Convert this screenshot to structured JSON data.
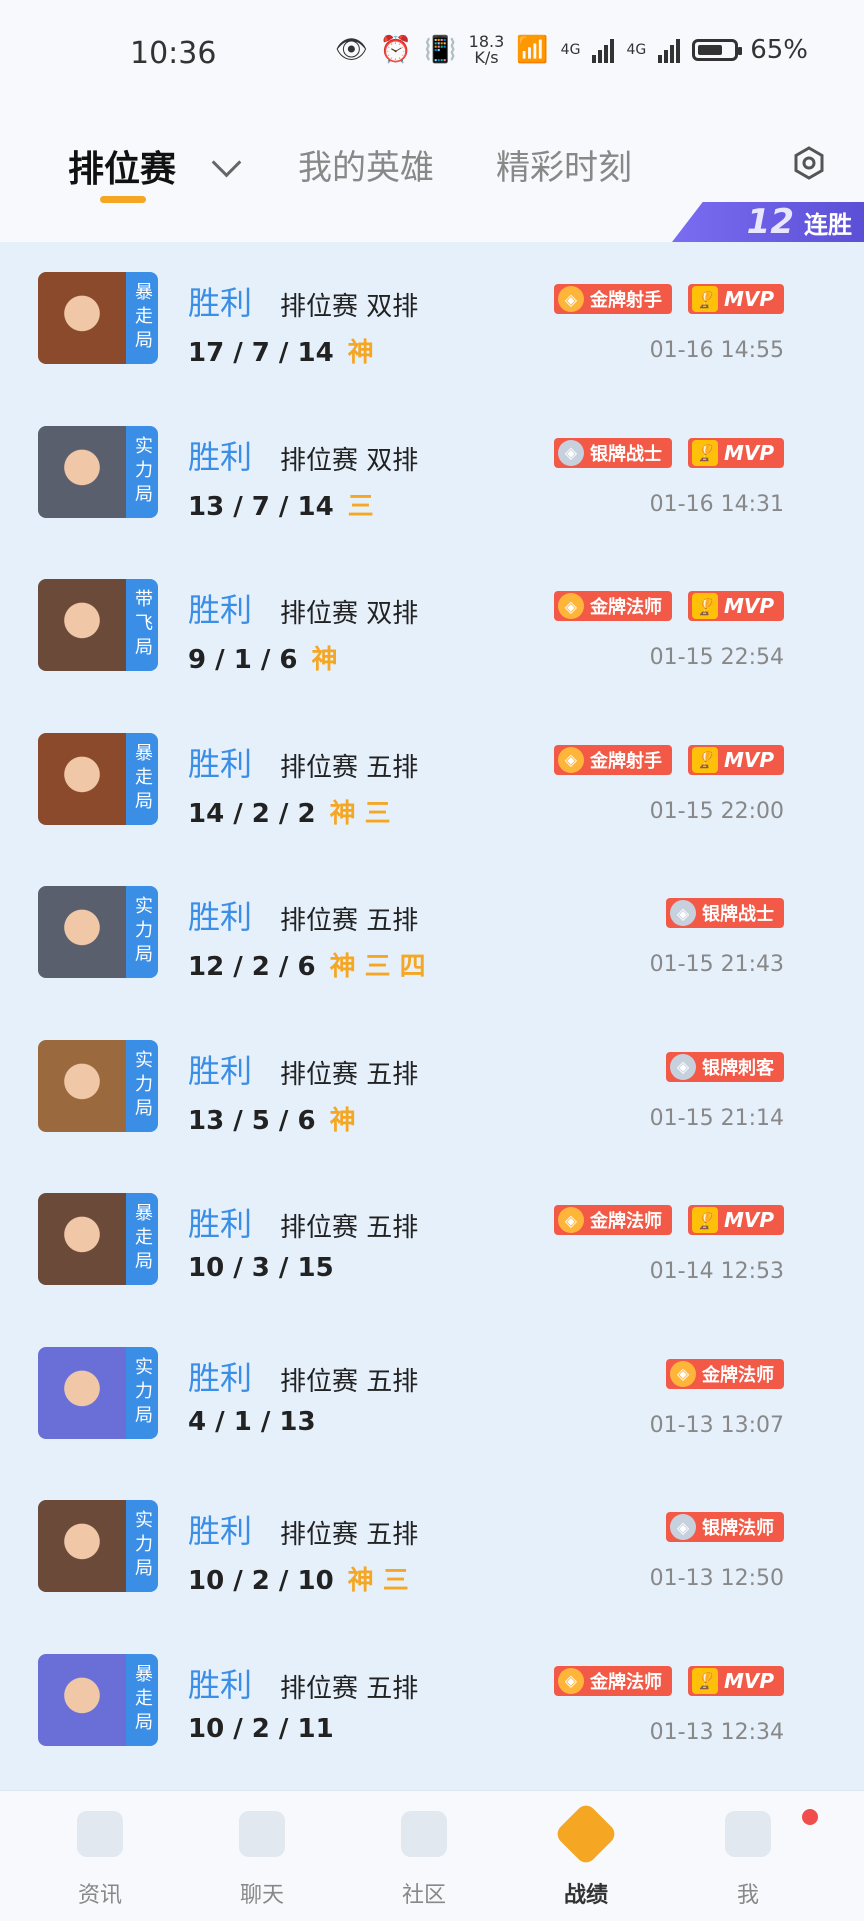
{
  "status_bar": {
    "time": "10:36",
    "speed_value": "18.3",
    "speed_unit": "K/s",
    "net1": "4G",
    "net2": "4G",
    "battery": "65%"
  },
  "header": {
    "tabs": [
      {
        "label": "排位赛",
        "active": true
      },
      {
        "label": "我的英雄",
        "active": false
      },
      {
        "label": "精彩时刻",
        "active": false
      }
    ],
    "streak_number": "12",
    "streak_label": "连胜"
  },
  "matches": [
    {
      "mode_tag": "暴走局",
      "result": "胜利",
      "mode": "排位赛 双排",
      "kda": "17 / 7 / 14",
      "medals": "神",
      "badges": [
        {
          "type": "gold",
          "label": "金牌射手"
        },
        {
          "type": "mvp",
          "label": "MVP"
        }
      ],
      "time": "01-16 14:55",
      "face_color": "#8b4a2b"
    },
    {
      "mode_tag": "实力局",
      "result": "胜利",
      "mode": "排位赛 双排",
      "kda": "13 / 7 / 14",
      "medals": "三",
      "badges": [
        {
          "type": "silver",
          "label": "银牌战士"
        },
        {
          "type": "mvp",
          "label": "MVP"
        }
      ],
      "time": "01-16 14:31",
      "face_color": "#5a5f6e"
    },
    {
      "mode_tag": "带飞局",
      "result": "胜利",
      "mode": "排位赛 双排",
      "kda": "9 / 1 / 6",
      "medals": "神",
      "badges": [
        {
          "type": "gold",
          "label": "金牌法师"
        },
        {
          "type": "mvp",
          "label": "MVP"
        }
      ],
      "time": "01-15 22:54",
      "face_color": "#6b4a3a"
    },
    {
      "mode_tag": "暴走局",
      "result": "胜利",
      "mode": "排位赛 五排",
      "kda": "14 / 2 / 2",
      "medals": "神 三",
      "badges": [
        {
          "type": "gold",
          "label": "金牌射手"
        },
        {
          "type": "mvp",
          "label": "MVP"
        }
      ],
      "time": "01-15 22:00",
      "face_color": "#8b4a2b"
    },
    {
      "mode_tag": "实力局",
      "result": "胜利",
      "mode": "排位赛 五排",
      "kda": "12 / 2 / 6",
      "medals": "神 三 四",
      "badges": [
        {
          "type": "silver",
          "label": "银牌战士"
        }
      ],
      "time": "01-15 21:43",
      "face_color": "#5a5f6e"
    },
    {
      "mode_tag": "实力局",
      "result": "胜利",
      "mode": "排位赛 五排",
      "kda": "13 / 5 / 6",
      "medals": "神",
      "badges": [
        {
          "type": "silver",
          "label": "银牌刺客"
        }
      ],
      "time": "01-15 21:14",
      "face_color": "#9a6a3e"
    },
    {
      "mode_tag": "暴走局",
      "result": "胜利",
      "mode": "排位赛 五排",
      "kda": "10 / 3 / 15",
      "medals": "",
      "badges": [
        {
          "type": "gold",
          "label": "金牌法师"
        },
        {
          "type": "mvp",
          "label": "MVP"
        }
      ],
      "time": "01-14 12:53",
      "face_color": "#6b4a3a"
    },
    {
      "mode_tag": "实力局",
      "result": "胜利",
      "mode": "排位赛 五排",
      "kda": "4 / 1 / 13",
      "medals": "",
      "badges": [
        {
          "type": "gold",
          "label": "金牌法师"
        }
      ],
      "time": "01-13 13:07",
      "face_color": "#6a6fd8"
    },
    {
      "mode_tag": "实力局",
      "result": "胜利",
      "mode": "排位赛 五排",
      "kda": "10 / 2 / 10",
      "medals": "神 三",
      "badges": [
        {
          "type": "silver",
          "label": "银牌法师"
        }
      ],
      "time": "01-13 12:50",
      "face_color": "#6b4a3a"
    },
    {
      "mode_tag": "暴走局",
      "result": "胜利",
      "mode": "排位赛 五排",
      "kda": "10 / 2 / 11",
      "medals": "",
      "badges": [
        {
          "type": "gold",
          "label": "金牌法师"
        },
        {
          "type": "mvp",
          "label": "MVP"
        }
      ],
      "time": "01-13 12:34",
      "face_color": "#6a6fd8"
    }
  ],
  "bottom_nav": [
    {
      "label": "资讯",
      "icon": "news-icon",
      "active": false
    },
    {
      "label": "聊天",
      "icon": "chat-icon",
      "active": false
    },
    {
      "label": "社区",
      "icon": "community-icon",
      "active": false
    },
    {
      "label": "战绩",
      "icon": "record-icon",
      "active": true
    },
    {
      "label": "我",
      "icon": "profile-icon",
      "active": false
    }
  ],
  "colors": {
    "accent": "#f5a623",
    "win": "#3a8ee6",
    "badge_red": "#f25a47"
  }
}
